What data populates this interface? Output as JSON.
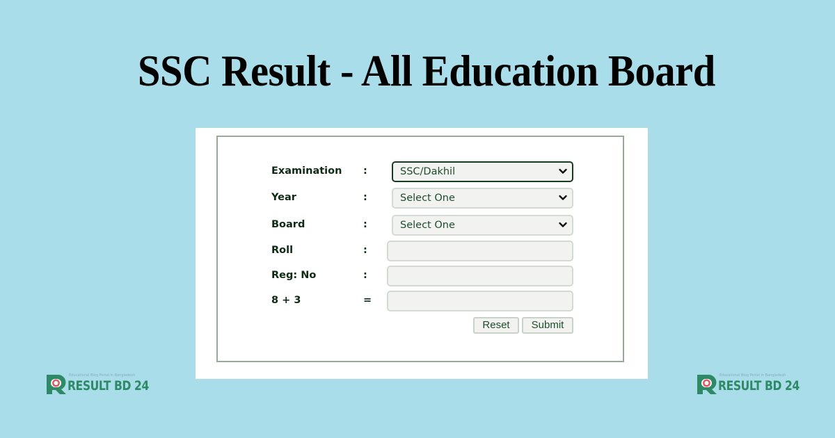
{
  "header": {
    "title": "SSC Result - All Education Board"
  },
  "form": {
    "fields": [
      {
        "label": "Examination",
        "separator": ":",
        "type": "select",
        "value": "SSC/Dakhil",
        "focused": true
      },
      {
        "label": "Year",
        "separator": ":",
        "type": "select",
        "value": "Select One"
      },
      {
        "label": "Board",
        "separator": ":",
        "type": "select",
        "value": "Select One"
      },
      {
        "label": "Roll",
        "separator": ":",
        "type": "text",
        "value": ""
      },
      {
        "label": "Reg: No",
        "separator": ":",
        "type": "text",
        "value": ""
      },
      {
        "label": "8 + 3",
        "separator": "=",
        "type": "text",
        "value": ""
      }
    ],
    "buttons": {
      "reset": "Reset",
      "submit": "Submit"
    }
  },
  "logos": {
    "brand": "RESULT BD 24",
    "tagline": "Educational Blog Portal in Bangladesh",
    "icons": {
      "mark": "r-logo-icon",
      "dropdown": "chevron-down-icon"
    }
  },
  "colors": {
    "background": "#a8dde9",
    "brand_green": "#2e8a66",
    "brand_red": "#e0565f",
    "text_green": "#1e4d2b",
    "frame_border": "#98ab98"
  }
}
